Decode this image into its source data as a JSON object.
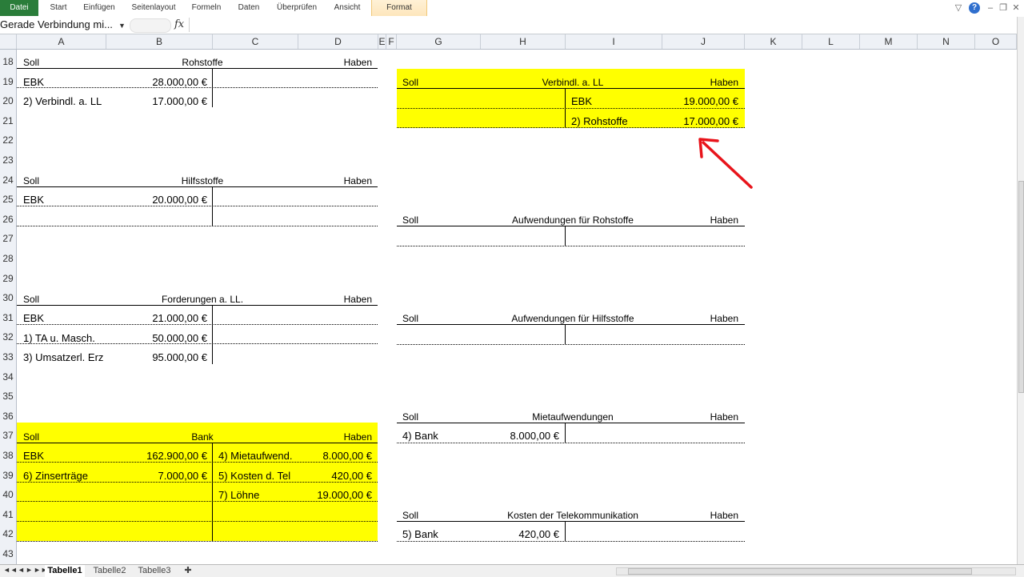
{
  "ribbon": {
    "tabs": [
      "Datei",
      "Start",
      "Einfügen",
      "Seitenlayout",
      "Formeln",
      "Daten",
      "Überprüfen",
      "Ansicht",
      "Format"
    ],
    "help_label": "?"
  },
  "formula_bar": {
    "name_box": "Gerade Verbindung mi...",
    "fx_label": "fx",
    "formula": ""
  },
  "columns": [
    "A",
    "B",
    "C",
    "D",
    "E",
    "F",
    "G",
    "H",
    "I",
    "J",
    "K",
    "L",
    "M",
    "N",
    "O"
  ],
  "rows": [
    "18",
    "19",
    "20",
    "21",
    "22",
    "23",
    "24",
    "25",
    "26",
    "27",
    "28",
    "29",
    "30",
    "31",
    "32",
    "33",
    "34",
    "35",
    "36",
    "37",
    "38",
    "39",
    "40",
    "41",
    "42",
    "43"
  ],
  "accounts": {
    "soll": "Soll",
    "haben": "Haben",
    "rohstoffe": {
      "title": "Rohstoffe",
      "r1_label": "EBK",
      "r1_value": "28.000,00 €",
      "r2_label": "2) Verbindl. a. LL",
      "r2_value": "17.000,00 €"
    },
    "hilfsstoffe": {
      "title": "Hilfsstoffe",
      "r1_label": "EBK",
      "r1_value": "20.000,00 €"
    },
    "forderungen": {
      "title": "Forderungen a. LL.",
      "r1_label": "EBK",
      "r1_value": "21.000,00 €",
      "r2_label": "1) TA u. Masch.",
      "r2_value": "50.000,00 €",
      "r3_label": "3) Umsatzerl. Erz",
      "r3_value": "95.000,00 €"
    },
    "bank": {
      "title": "Bank",
      "soll": [
        {
          "label": "EBK",
          "value": "162.900,00 €"
        },
        {
          "label": "6) Zinserträge",
          "value": "7.000,00 €"
        }
      ],
      "haben": [
        {
          "label": "4) Mietaufwend.",
          "value": "8.000,00 €"
        },
        {
          "label": "5) Kosten d. Tel",
          "value": "420,00 €"
        },
        {
          "label": "7) Löhne",
          "value": "19.000,00 €"
        }
      ]
    },
    "verbindl": {
      "title": "Verbindl. a. LL",
      "r1_label": "EBK",
      "r1_value": "19.000,00 €",
      "r2_label": "2) Rohstoffe",
      "r2_value": "17.000,00 €"
    },
    "aufw_rohstoffe": {
      "title": "Aufwendungen für Rohstoffe"
    },
    "aufw_hilfsstoffe": {
      "title": "Aufwendungen für Hilfsstoffe"
    },
    "mietaufwendungen": {
      "title": "Mietaufwendungen",
      "r1_label": "4) Bank",
      "r1_value": "8.000,00 €"
    },
    "telekom": {
      "title": "Kosten der Telekommunikation",
      "r1_label": "5) Bank",
      "r1_value": "420,00 €"
    }
  },
  "annotation": {
    "arrow_color": "#e8141b"
  },
  "colors": {
    "highlight": "#ffff00",
    "file_tab": "#2a7d3a"
  },
  "sheets": [
    "Tabelle1",
    "Tabelle2",
    "Tabelle3"
  ],
  "sheet_nav": [
    "◄◄",
    "◄",
    "►",
    "►►"
  ]
}
